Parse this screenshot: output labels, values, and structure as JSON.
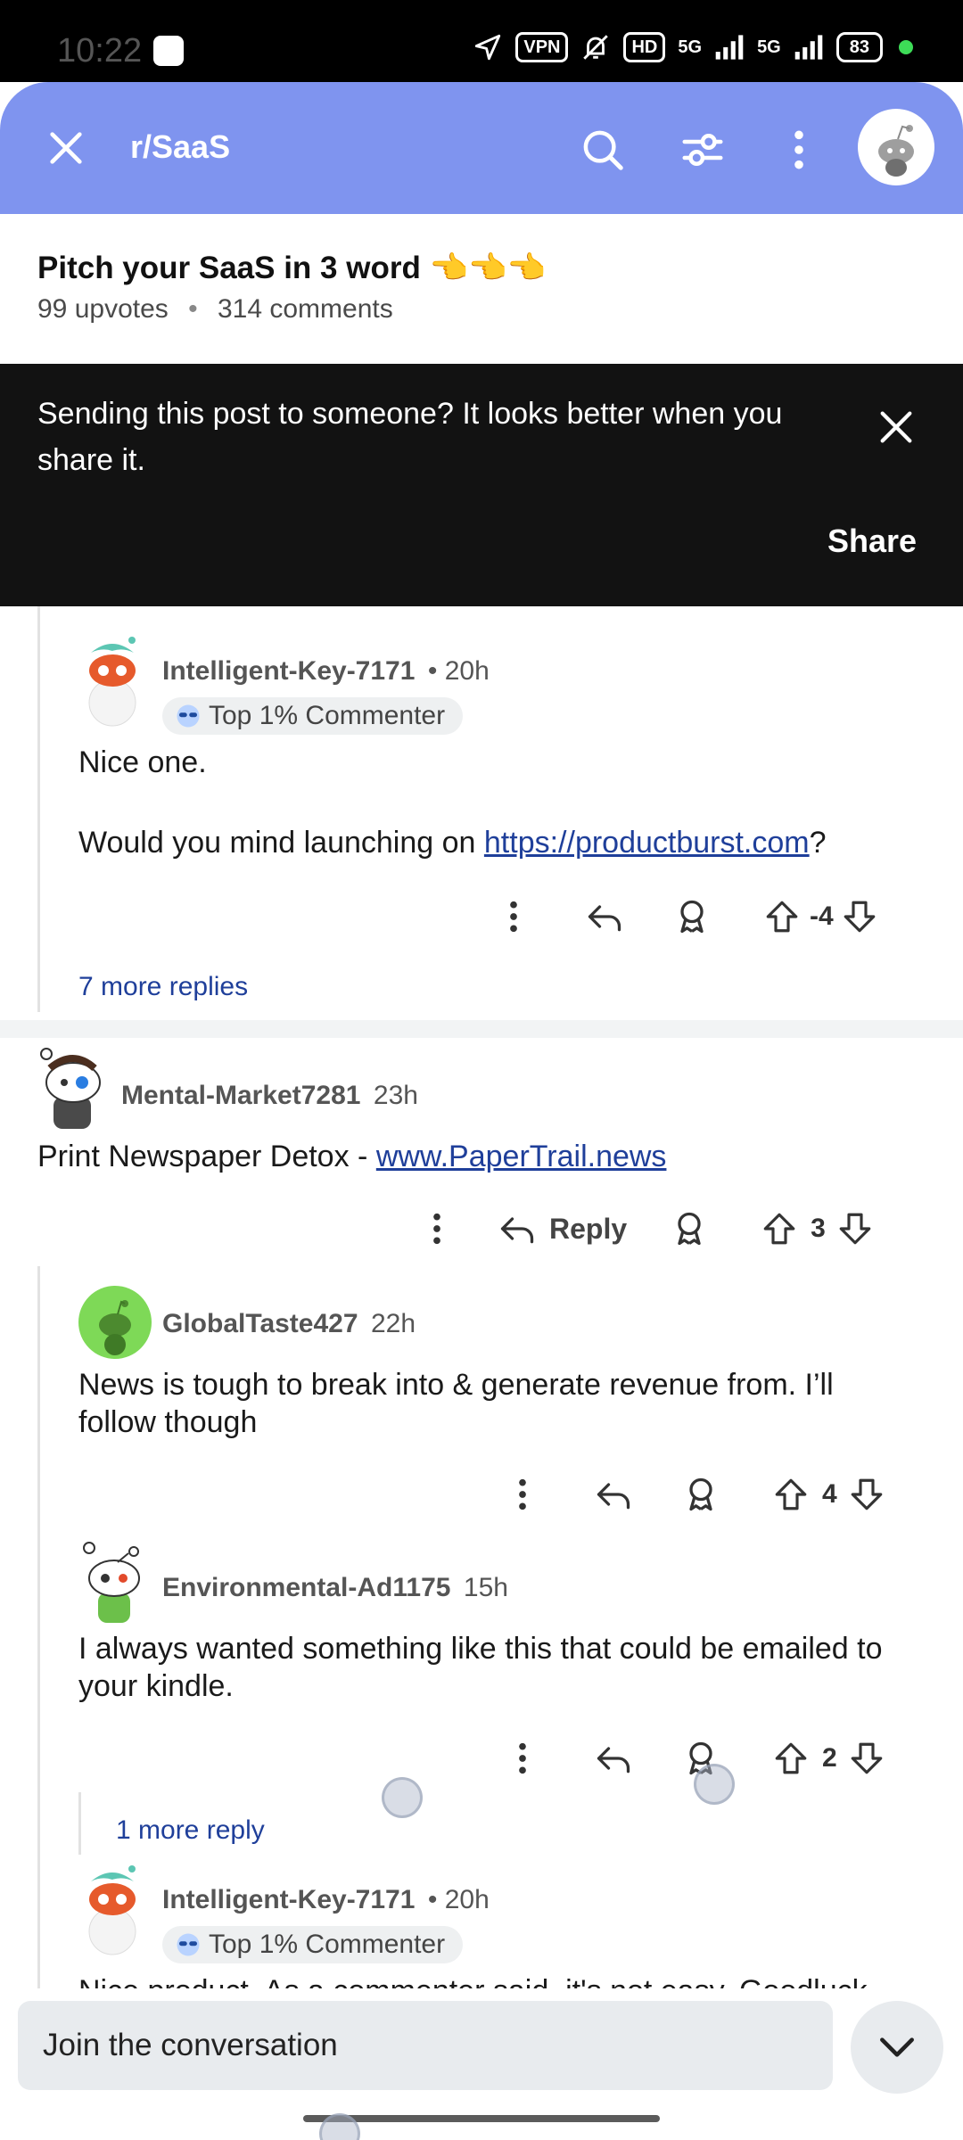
{
  "status": {
    "time": "10:22",
    "vpn": "VPN",
    "hd": "HD",
    "net1": "5G",
    "net2": "5G",
    "battery": "83"
  },
  "appbar": {
    "subreddit": "r/SaaS",
    "close_icon": "close-icon",
    "search_icon": "search-icon",
    "filter_icon": "filter-icon",
    "more_icon": "kebab-menu-icon"
  },
  "post": {
    "title": "Pitch your SaaS in 3 word 👈👈👈",
    "upvotes": "99 upvotes",
    "separator": "•",
    "comments": "314 comments"
  },
  "toast": {
    "message": "Sending this post to someone? It looks better when you share it.",
    "share_label": "Share"
  },
  "comments": [
    {
      "author": "Intelligent-Key-7171",
      "time": "• 20h",
      "badge": "Top 1% Commenter",
      "text1": "Nice one.",
      "text2_prefix": "Would you mind launching on ",
      "text2_link": "https://productburst.com",
      "text2_suffix": "?",
      "score": "-4",
      "more_replies": "7 more replies"
    },
    {
      "author": "Mental-Market7281",
      "time": "23h",
      "text_prefix": "Print Newspaper Detox - ",
      "text_link": "www.PaperTrail.news",
      "reply_label": "Reply",
      "score": "3"
    },
    {
      "author": "GlobalTaste427",
      "time": "22h",
      "text": "News is tough to break into & generate revenue from. I’ll follow though",
      "score": "4"
    },
    {
      "author": "Environmental-Ad1175",
      "time": "15h",
      "text": "I always wanted something like this that could be emailed to your kindle.",
      "score": "2",
      "more_replies": "1 more reply"
    },
    {
      "author": "Intelligent-Key-7171",
      "time": "• 20h",
      "badge": "Top 1% Commenter",
      "text": "Nice product. As a commenter said, it's not easy. Goodluck"
    }
  ],
  "bottom": {
    "join_placeholder": "Join the conversation"
  }
}
